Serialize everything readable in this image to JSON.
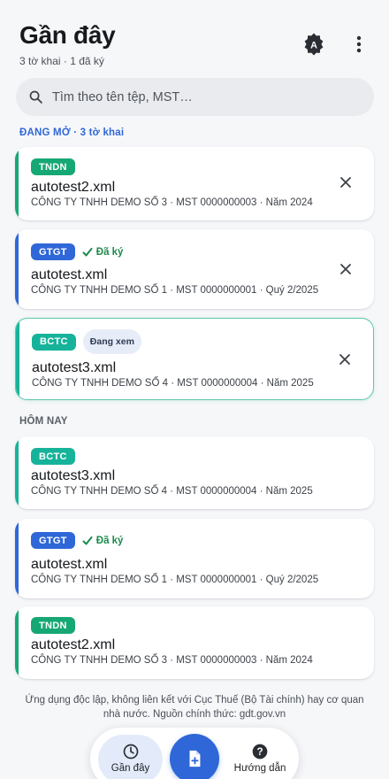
{
  "header": {
    "title": "Gần đây",
    "subtitle": "3 tờ khai · 1 đã ký"
  },
  "search": {
    "placeholder": "Tìm theo tên tệp, MST…"
  },
  "sections": {
    "open_label": "ĐANG MỞ · 3 tờ khai",
    "today_label": "HÔM NAY"
  },
  "colors": {
    "TNDN": "#16a874",
    "GTGT": "#2f67d8",
    "BCTC": "#16b39a",
    "accent": "#2f67d8",
    "signed": "#1b8a4a"
  },
  "open_files": [
    {
      "type": "TNDN",
      "signed": false,
      "viewing": false,
      "name": "autotest2.xml",
      "meta": "CÔNG TY TNHH DEMO SỐ 3 · MST 0000000003 · Năm 2024"
    },
    {
      "type": "GTGT",
      "signed": true,
      "signed_label": "Đã ký",
      "viewing": false,
      "name": "autotest.xml",
      "meta": "CÔNG TY TNHH DEMO SỐ 1 · MST 0000000001 · Quý 2/2025"
    },
    {
      "type": "BCTC",
      "signed": false,
      "viewing": true,
      "viewing_label": "Đang xem",
      "name": "autotest3.xml",
      "meta": "CÔNG TY TNHH DEMO SỐ 4 · MST 0000000004 · Năm 2025"
    }
  ],
  "today_files": [
    {
      "type": "BCTC",
      "signed": false,
      "name": "autotest3.xml",
      "meta": "CÔNG TY TNHH DEMO SỐ 4 · MST 0000000004 · Năm 2025"
    },
    {
      "type": "GTGT",
      "signed": true,
      "signed_label": "Đã ký",
      "name": "autotest.xml",
      "meta": "CÔNG TY TNHH DEMO SỐ 1 · MST 0000000001 · Quý 2/2025"
    },
    {
      "type": "TNDN",
      "signed": false,
      "name": "autotest2.xml",
      "meta": "CÔNG TY TNHH DEMO SỐ 3 · MST 0000000003 · Năm 2024"
    }
  ],
  "footer": {
    "disclaimer": "Ứng dụng độc lập, không liên kết với Cục Thuế (Bộ Tài chính) hay cơ quan nhà nước. Nguồn chính thức: gdt.gov.vn"
  },
  "nav": {
    "recent_label": "Gần đây",
    "help_label": "Hướng dẫn"
  },
  "icons": {
    "font_icon": "font-a-icon",
    "more": "more-vertical-icon",
    "search": "search-icon",
    "close": "close-icon",
    "check": "check-icon",
    "clock": "clock-icon",
    "new_file": "new-file-icon",
    "help": "help-icon"
  }
}
